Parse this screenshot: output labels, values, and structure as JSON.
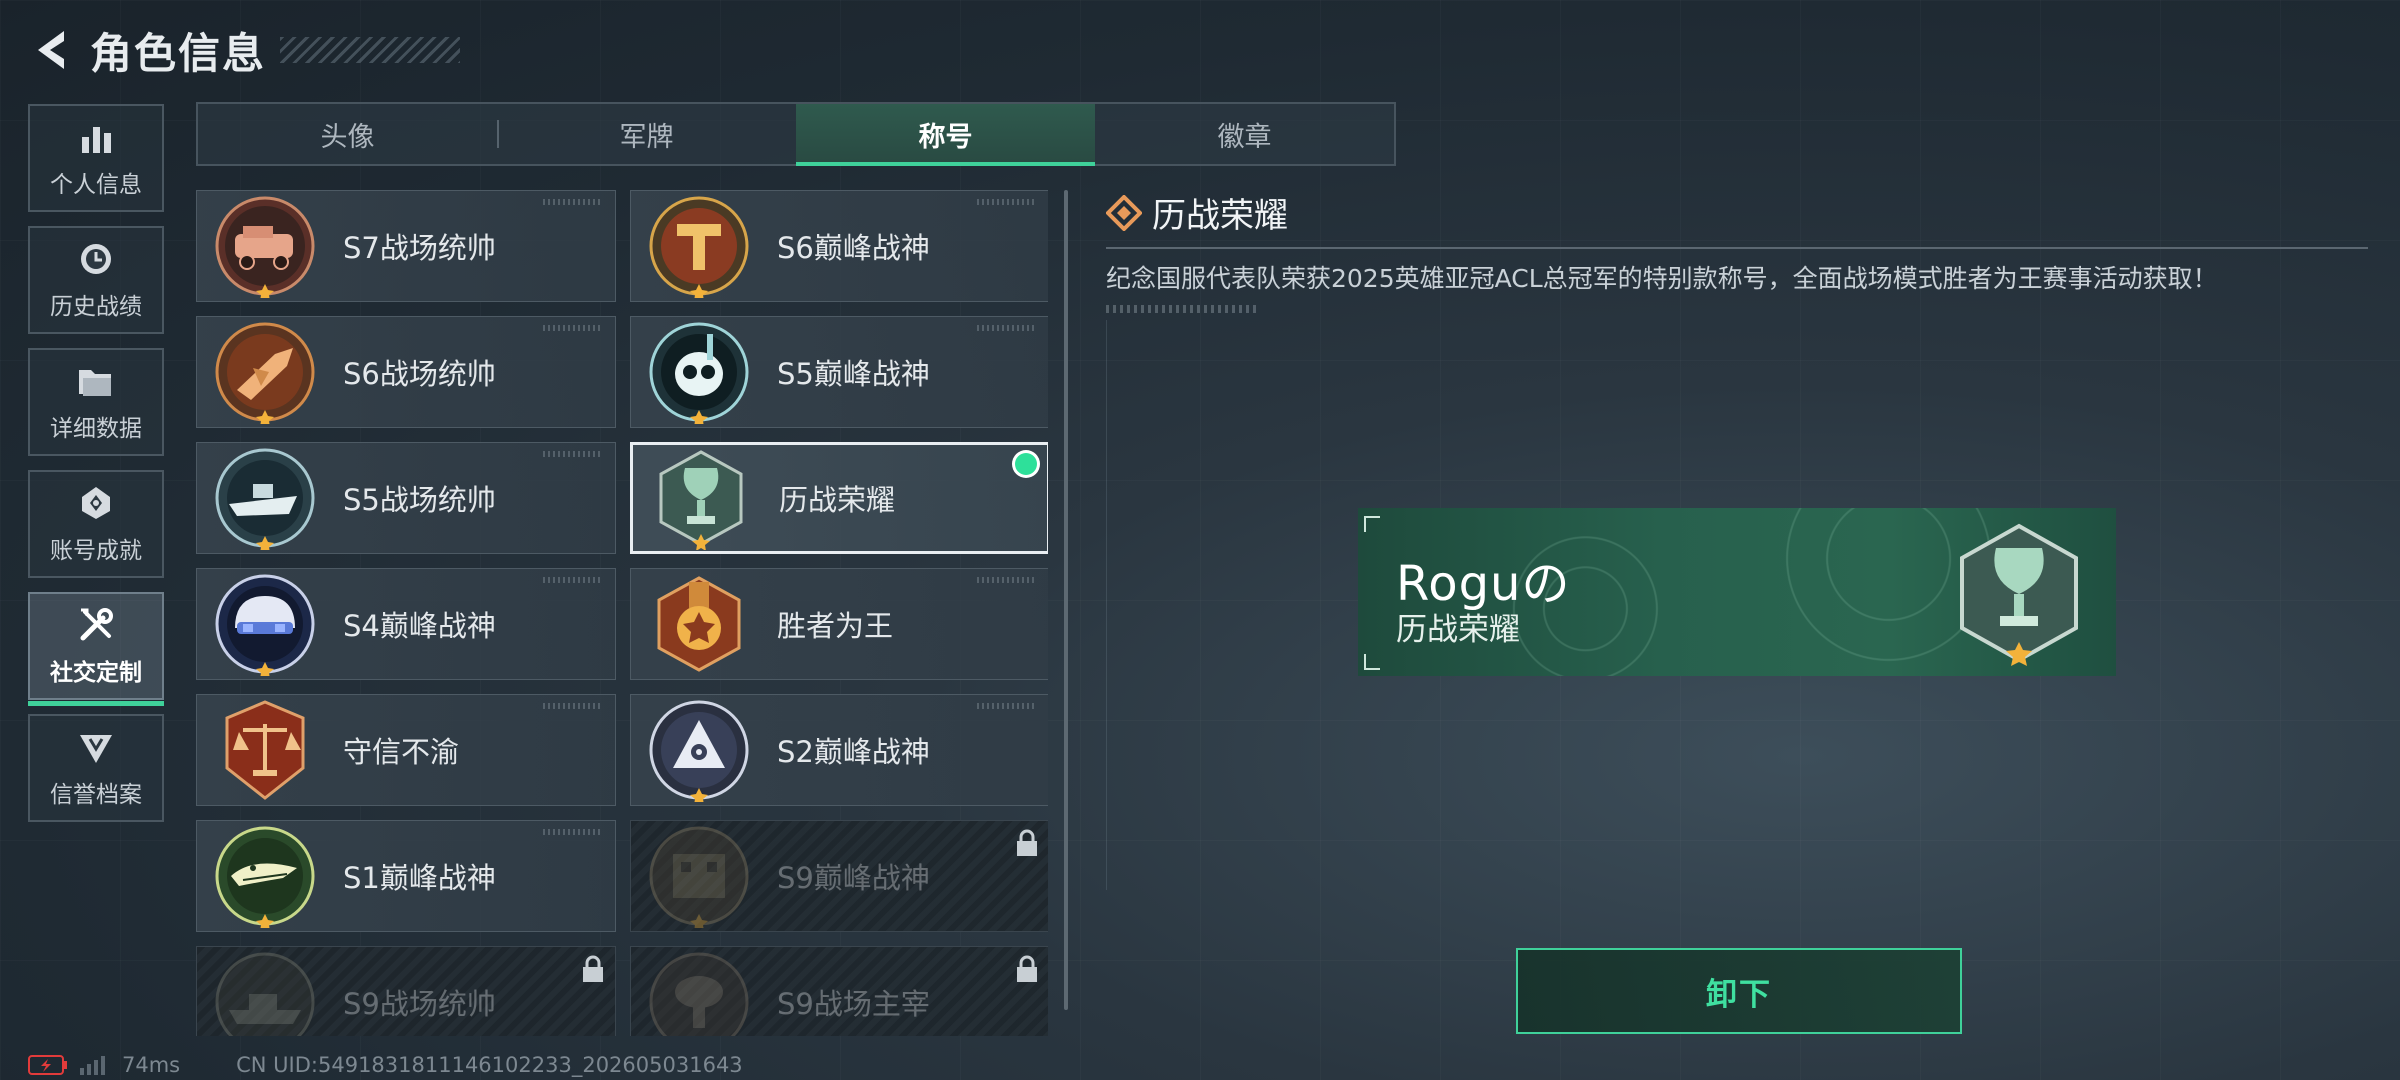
{
  "header": {
    "title": "角色信息"
  },
  "nav": {
    "items": [
      {
        "label": "个人信息",
        "icon": "bar-chart-icon"
      },
      {
        "label": "历史战绩",
        "icon": "clock-icon"
      },
      {
        "label": "详细数据",
        "icon": "folder-icon"
      },
      {
        "label": "账号成就",
        "icon": "achievement-icon"
      },
      {
        "label": "社交定制",
        "icon": "tools-icon",
        "active": true
      },
      {
        "label": "信誉档案",
        "icon": "shield-emblem-icon"
      }
    ]
  },
  "tabs": [
    {
      "label": "头像"
    },
    {
      "label": "军牌"
    },
    {
      "label": "称号",
      "active": true
    },
    {
      "label": "徽章"
    }
  ],
  "titles": [
    {
      "label": "S7战场统帅",
      "icon": "armored-vehicle-badge-icon"
    },
    {
      "label": "S6巅峰战神",
      "icon": "t-emblem-badge-icon"
    },
    {
      "label": "S6战场统帅",
      "icon": "jet-fighter-badge-icon"
    },
    {
      "label": "S5巅峰战神",
      "icon": "diver-skull-badge-icon"
    },
    {
      "label": "S5战场统帅",
      "icon": "speedboat-badge-icon"
    },
    {
      "label": "历战荣耀",
      "icon": "trophy-badge-icon",
      "selected": true,
      "equipped": true
    },
    {
      "label": "S4巅峰战神",
      "icon": "helmet-badge-icon"
    },
    {
      "label": "胜者为王",
      "icon": "star-medal-badge-icon"
    },
    {
      "label": "守信不渝",
      "icon": "scales-badge-icon"
    },
    {
      "label": "S2巅峰战神",
      "icon": "triangle-eye-badge-icon"
    },
    {
      "label": "S1巅峰战神",
      "icon": "crocodile-badge-icon"
    },
    {
      "label": "S9巅峰战神",
      "icon": "building-badge-icon",
      "locked": true
    },
    {
      "label": "S9战场统帅",
      "icon": "warship-badge-icon",
      "locked": true
    },
    {
      "label": "S9战场主宰",
      "icon": "mushroom-cloud-badge-icon",
      "locked": true
    }
  ],
  "detail": {
    "title": "历战荣耀",
    "description": "纪念国服代表队荣获2025英雄亚冠ACL总冠军的特别款称号，全面战场模式胜者为王赛事活动获取！"
  },
  "nameplate": {
    "player_name": "Roguの",
    "title": "历战荣耀"
  },
  "actions": {
    "unequip_label": "卸下"
  },
  "status": {
    "ping": "74ms",
    "uid": "CN UID:5491831811146102233_202605031643"
  },
  "colors": {
    "accent": "#3fd19a",
    "equipped": "#2ee09a",
    "nameplate": "#27604d"
  }
}
